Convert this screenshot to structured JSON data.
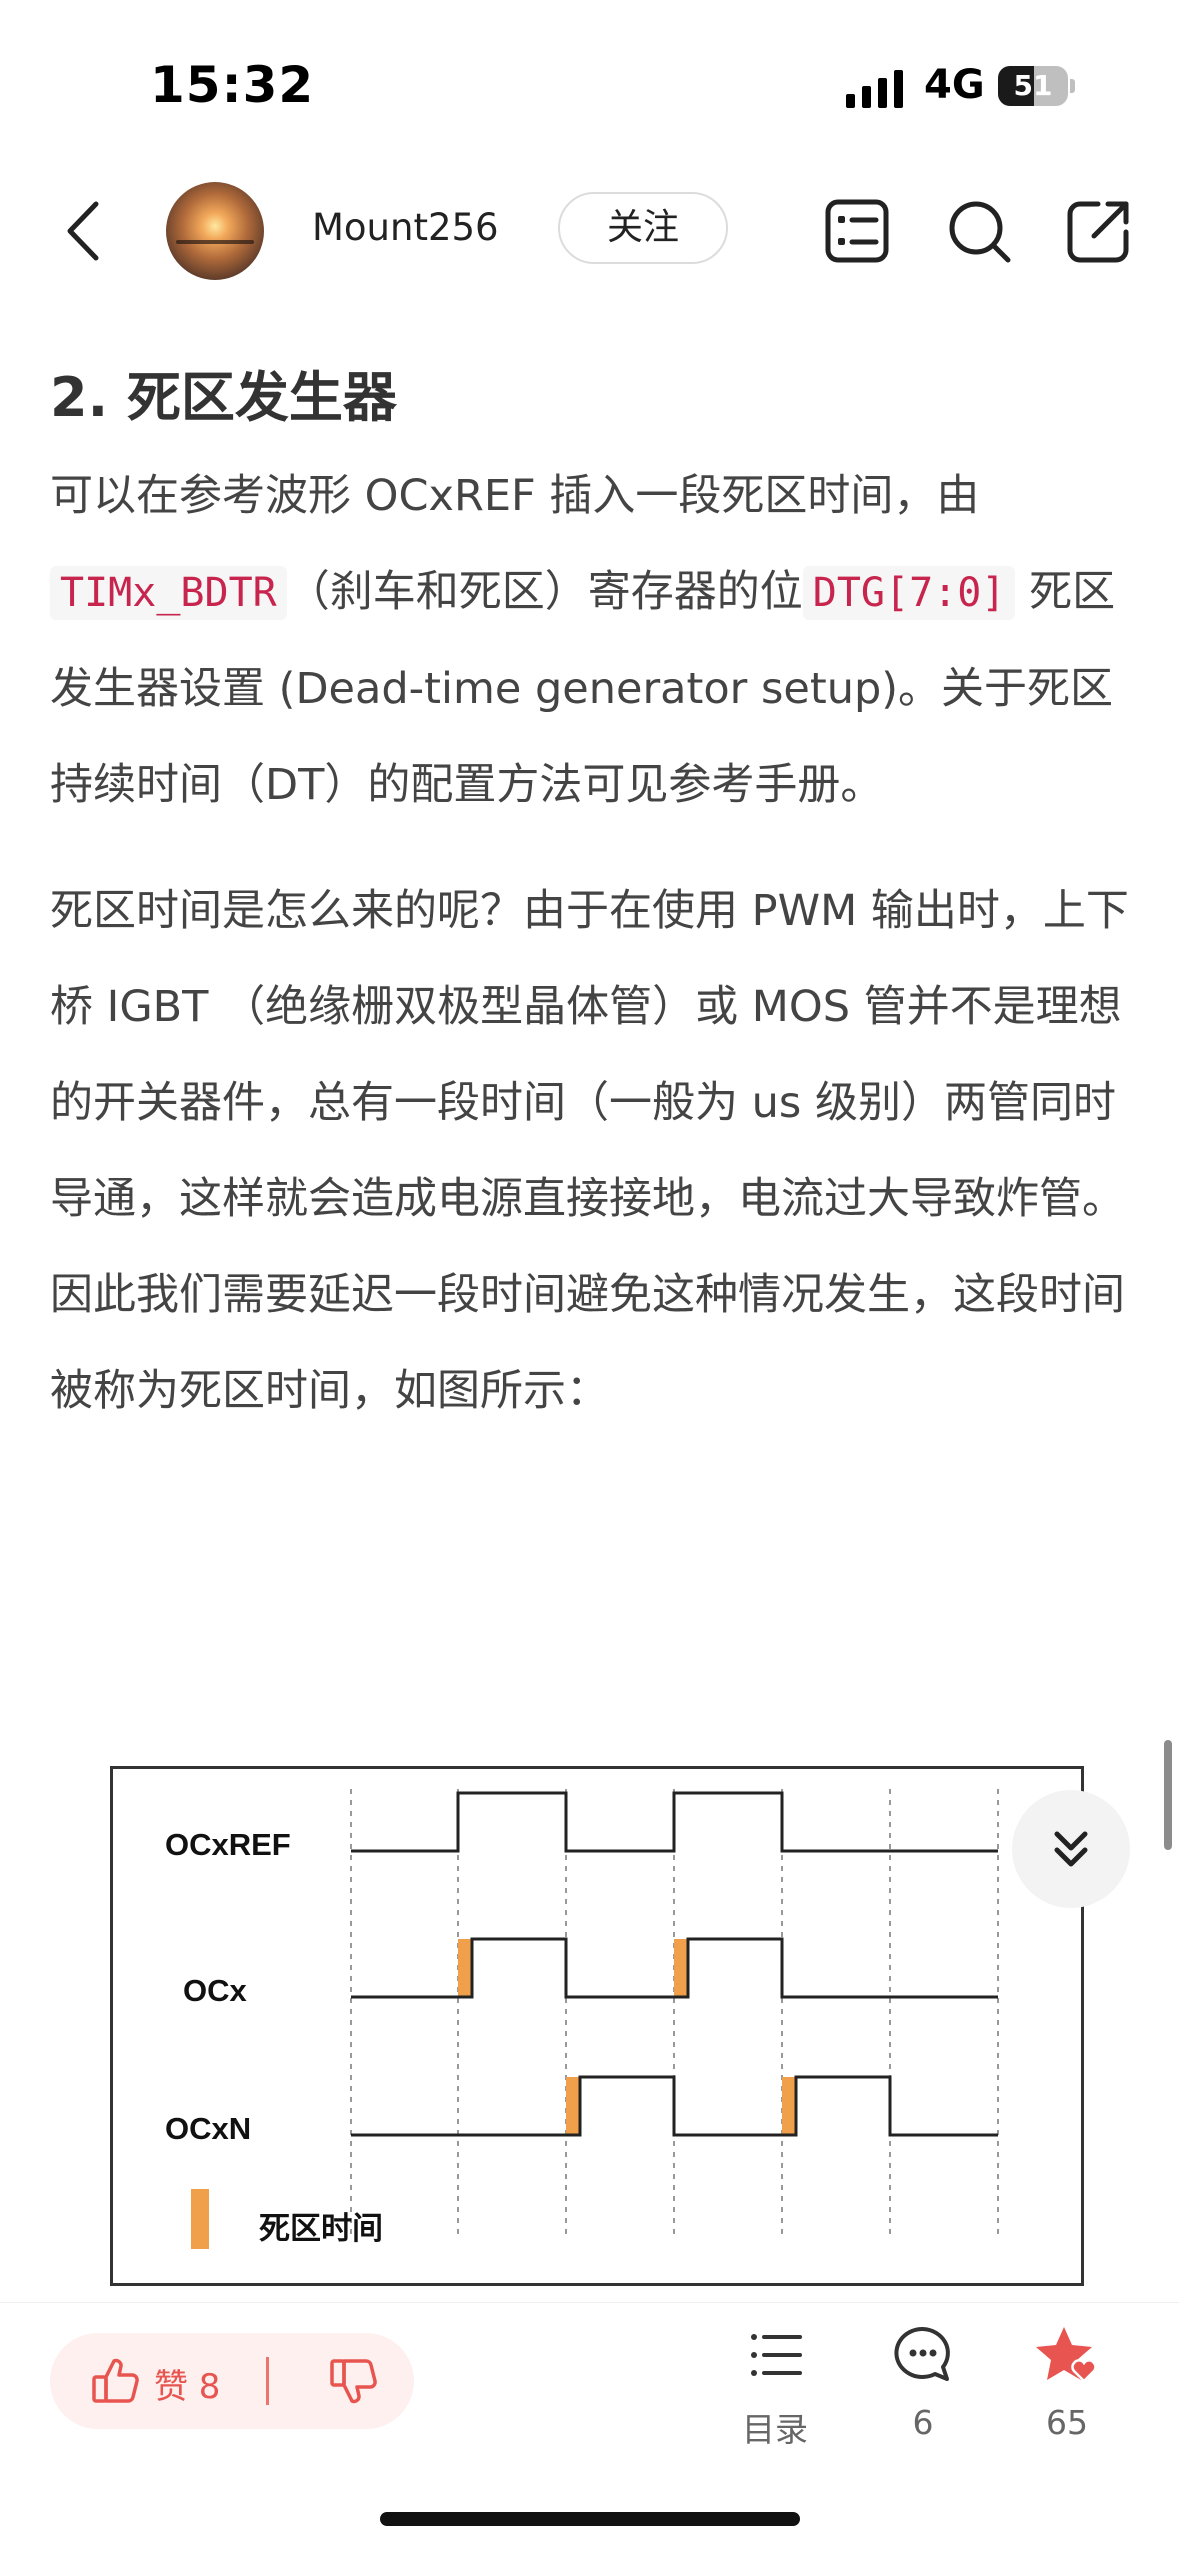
{
  "status_bar": {
    "time": "15:32",
    "network": "4G",
    "battery_level": "51"
  },
  "header": {
    "username": "Mount256",
    "follow_label": "关注"
  },
  "article": {
    "section_title": "2. 死区发生器",
    "p1_line1": "可以在参考波形 OCxREF 插入一段死区时间，由",
    "p1_code1": "TIMx_BDTR",
    "p1_mid": "（刹车和死区）寄存器的位",
    "p1_code2": "DTG[7:0]",
    "p1_line3": "死区发生器设置 (Dead-time generator setup)。关于死区持续时间（DT）的配置方法可见参考手册。",
    "p2": "死区时间是怎么来的呢？由于在使用 PWM 输出时，上下桥 IGBT （绝缘栅双极型晶体管）或 MOS 管并不是理想的开关器件，总有一段时间（一般为 us 级别）两管同时导通，这样就会造成电源直接接地，电流过大导致炸管。因此我们需要延迟一段时间避免这种情况发生，这段时间被称为死区时间，如图所示："
  },
  "figure": {
    "signal_ocxref": "OCxREF",
    "signal_ocx": "OCx",
    "signal_ocxn": "OCxN",
    "legend_label": "死区时间",
    "deadtime_color": "#f0a04b"
  },
  "bottom_bar": {
    "like_label": "赞 8",
    "toc_label": "目录",
    "comment_count": "6",
    "favorite_count": "65",
    "accent_color": "#e8544f"
  }
}
